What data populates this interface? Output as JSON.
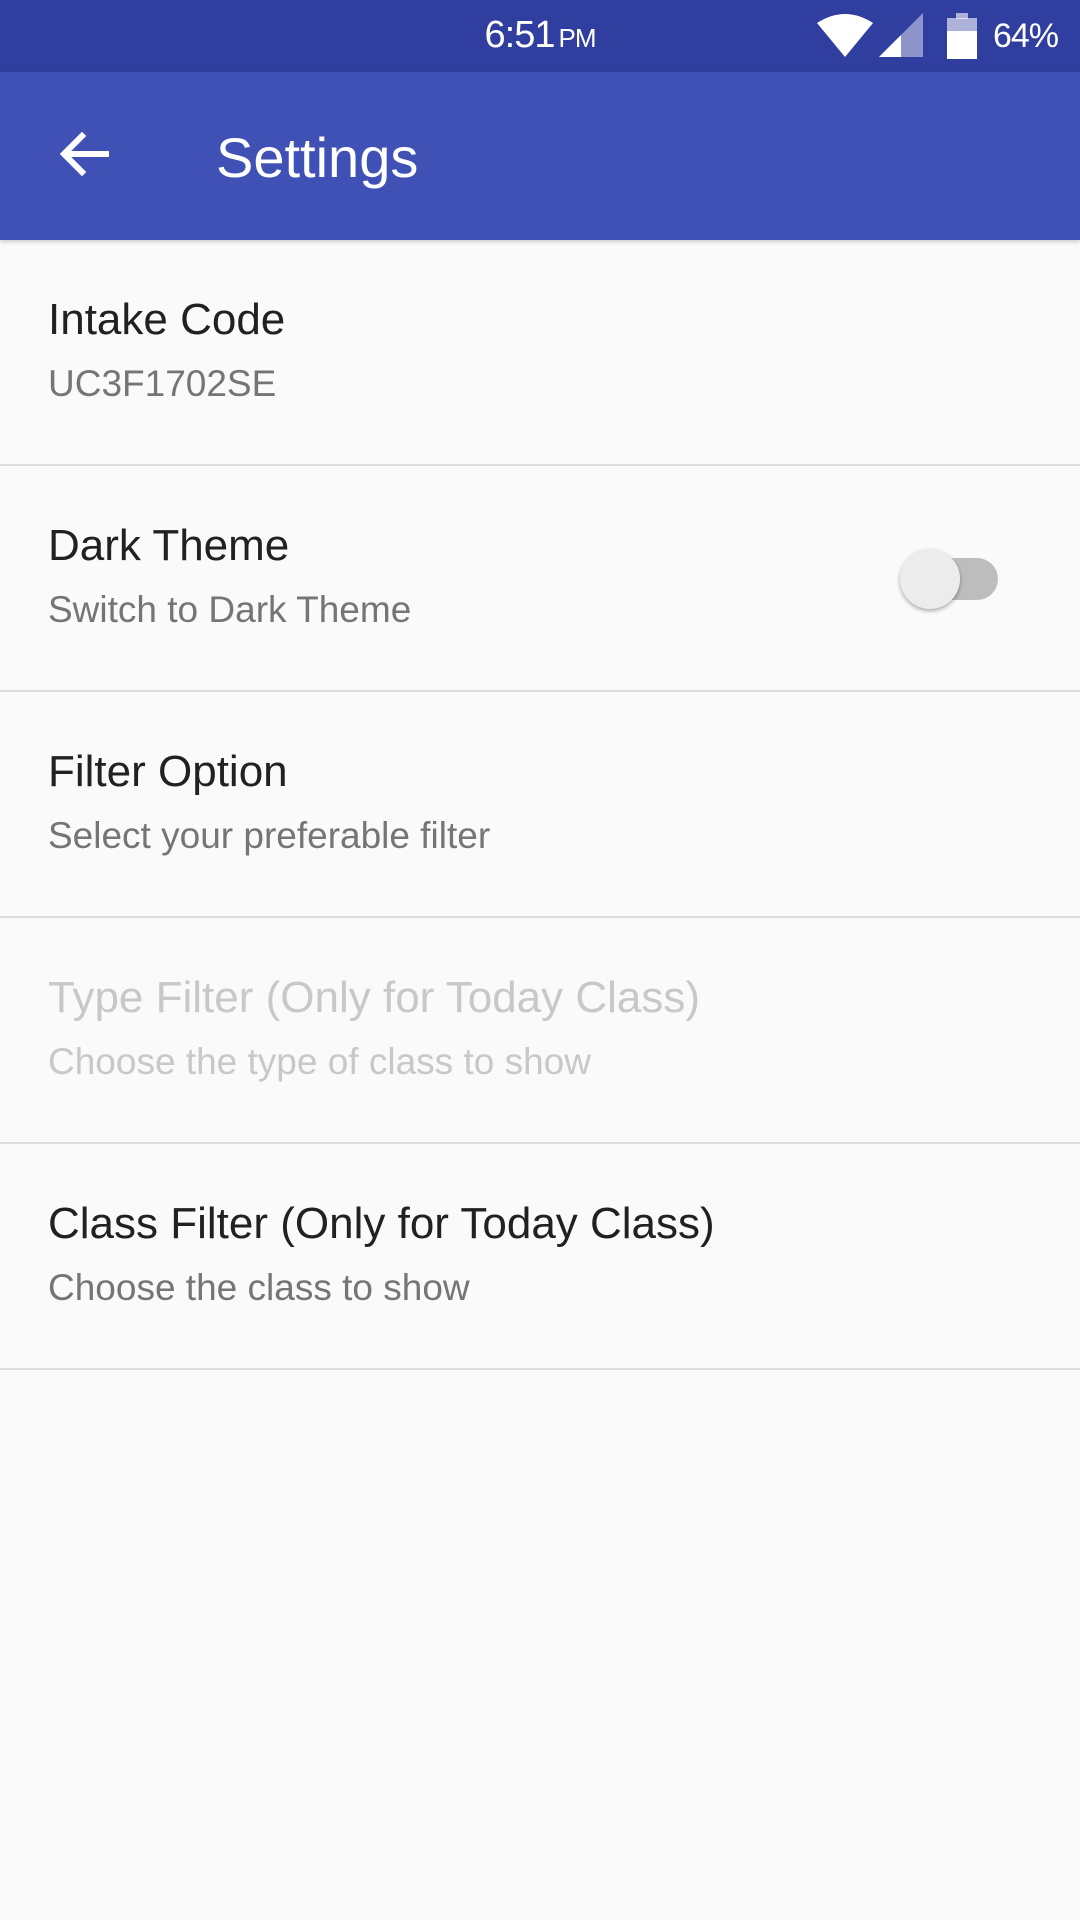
{
  "status_bar": {
    "time": "6:51",
    "ampm": "PM",
    "battery_percent": "64%",
    "icons": [
      "wifi-icon",
      "cell-signal-icon",
      "battery-icon"
    ]
  },
  "app_bar": {
    "title": "Settings",
    "back_icon": "arrow-back-icon",
    "background_color": "#3f51b5",
    "status_bar_color": "#303f9f"
  },
  "settings": [
    {
      "title": "Intake Code",
      "summary": "UC3F1702SE",
      "enabled": true
    },
    {
      "title": "Dark Theme",
      "summary": "Switch to Dark Theme",
      "enabled": true,
      "toggle_on": false
    },
    {
      "title": "Filter Option",
      "summary": "Select your preferable filter",
      "enabled": true
    },
    {
      "title": "Type Filter (Only for Today Class)",
      "summary": "Choose the type of class to show",
      "enabled": false
    },
    {
      "title": "Class Filter (Only for Today Class)",
      "summary": "Choose the class to show",
      "enabled": true
    }
  ]
}
